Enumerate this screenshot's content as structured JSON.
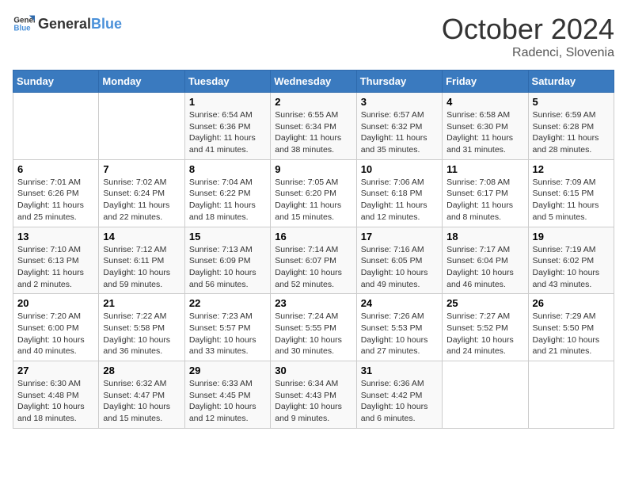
{
  "header": {
    "logo_general": "General",
    "logo_blue": "Blue",
    "month": "October 2024",
    "location": "Radenci, Slovenia"
  },
  "days_of_week": [
    "Sunday",
    "Monday",
    "Tuesday",
    "Wednesday",
    "Thursday",
    "Friday",
    "Saturday"
  ],
  "weeks": [
    [
      {
        "day": "",
        "info": ""
      },
      {
        "day": "",
        "info": ""
      },
      {
        "day": "1",
        "info": "Sunrise: 6:54 AM\nSunset: 6:36 PM\nDaylight: 11 hours and 41 minutes."
      },
      {
        "day": "2",
        "info": "Sunrise: 6:55 AM\nSunset: 6:34 PM\nDaylight: 11 hours and 38 minutes."
      },
      {
        "day": "3",
        "info": "Sunrise: 6:57 AM\nSunset: 6:32 PM\nDaylight: 11 hours and 35 minutes."
      },
      {
        "day": "4",
        "info": "Sunrise: 6:58 AM\nSunset: 6:30 PM\nDaylight: 11 hours and 31 minutes."
      },
      {
        "day": "5",
        "info": "Sunrise: 6:59 AM\nSunset: 6:28 PM\nDaylight: 11 hours and 28 minutes."
      }
    ],
    [
      {
        "day": "6",
        "info": "Sunrise: 7:01 AM\nSunset: 6:26 PM\nDaylight: 11 hours and 25 minutes."
      },
      {
        "day": "7",
        "info": "Sunrise: 7:02 AM\nSunset: 6:24 PM\nDaylight: 11 hours and 22 minutes."
      },
      {
        "day": "8",
        "info": "Sunrise: 7:04 AM\nSunset: 6:22 PM\nDaylight: 11 hours and 18 minutes."
      },
      {
        "day": "9",
        "info": "Sunrise: 7:05 AM\nSunset: 6:20 PM\nDaylight: 11 hours and 15 minutes."
      },
      {
        "day": "10",
        "info": "Sunrise: 7:06 AM\nSunset: 6:18 PM\nDaylight: 11 hours and 12 minutes."
      },
      {
        "day": "11",
        "info": "Sunrise: 7:08 AM\nSunset: 6:17 PM\nDaylight: 11 hours and 8 minutes."
      },
      {
        "day": "12",
        "info": "Sunrise: 7:09 AM\nSunset: 6:15 PM\nDaylight: 11 hours and 5 minutes."
      }
    ],
    [
      {
        "day": "13",
        "info": "Sunrise: 7:10 AM\nSunset: 6:13 PM\nDaylight: 11 hours and 2 minutes."
      },
      {
        "day": "14",
        "info": "Sunrise: 7:12 AM\nSunset: 6:11 PM\nDaylight: 10 hours and 59 minutes."
      },
      {
        "day": "15",
        "info": "Sunrise: 7:13 AM\nSunset: 6:09 PM\nDaylight: 10 hours and 56 minutes."
      },
      {
        "day": "16",
        "info": "Sunrise: 7:14 AM\nSunset: 6:07 PM\nDaylight: 10 hours and 52 minutes."
      },
      {
        "day": "17",
        "info": "Sunrise: 7:16 AM\nSunset: 6:05 PM\nDaylight: 10 hours and 49 minutes."
      },
      {
        "day": "18",
        "info": "Sunrise: 7:17 AM\nSunset: 6:04 PM\nDaylight: 10 hours and 46 minutes."
      },
      {
        "day": "19",
        "info": "Sunrise: 7:19 AM\nSunset: 6:02 PM\nDaylight: 10 hours and 43 minutes."
      }
    ],
    [
      {
        "day": "20",
        "info": "Sunrise: 7:20 AM\nSunset: 6:00 PM\nDaylight: 10 hours and 40 minutes."
      },
      {
        "day": "21",
        "info": "Sunrise: 7:22 AM\nSunset: 5:58 PM\nDaylight: 10 hours and 36 minutes."
      },
      {
        "day": "22",
        "info": "Sunrise: 7:23 AM\nSunset: 5:57 PM\nDaylight: 10 hours and 33 minutes."
      },
      {
        "day": "23",
        "info": "Sunrise: 7:24 AM\nSunset: 5:55 PM\nDaylight: 10 hours and 30 minutes."
      },
      {
        "day": "24",
        "info": "Sunrise: 7:26 AM\nSunset: 5:53 PM\nDaylight: 10 hours and 27 minutes."
      },
      {
        "day": "25",
        "info": "Sunrise: 7:27 AM\nSunset: 5:52 PM\nDaylight: 10 hours and 24 minutes."
      },
      {
        "day": "26",
        "info": "Sunrise: 7:29 AM\nSunset: 5:50 PM\nDaylight: 10 hours and 21 minutes."
      }
    ],
    [
      {
        "day": "27",
        "info": "Sunrise: 6:30 AM\nSunset: 4:48 PM\nDaylight: 10 hours and 18 minutes."
      },
      {
        "day": "28",
        "info": "Sunrise: 6:32 AM\nSunset: 4:47 PM\nDaylight: 10 hours and 15 minutes."
      },
      {
        "day": "29",
        "info": "Sunrise: 6:33 AM\nSunset: 4:45 PM\nDaylight: 10 hours and 12 minutes."
      },
      {
        "day": "30",
        "info": "Sunrise: 6:34 AM\nSunset: 4:43 PM\nDaylight: 10 hours and 9 minutes."
      },
      {
        "day": "31",
        "info": "Sunrise: 6:36 AM\nSunset: 4:42 PM\nDaylight: 10 hours and 6 minutes."
      },
      {
        "day": "",
        "info": ""
      },
      {
        "day": "",
        "info": ""
      }
    ]
  ]
}
